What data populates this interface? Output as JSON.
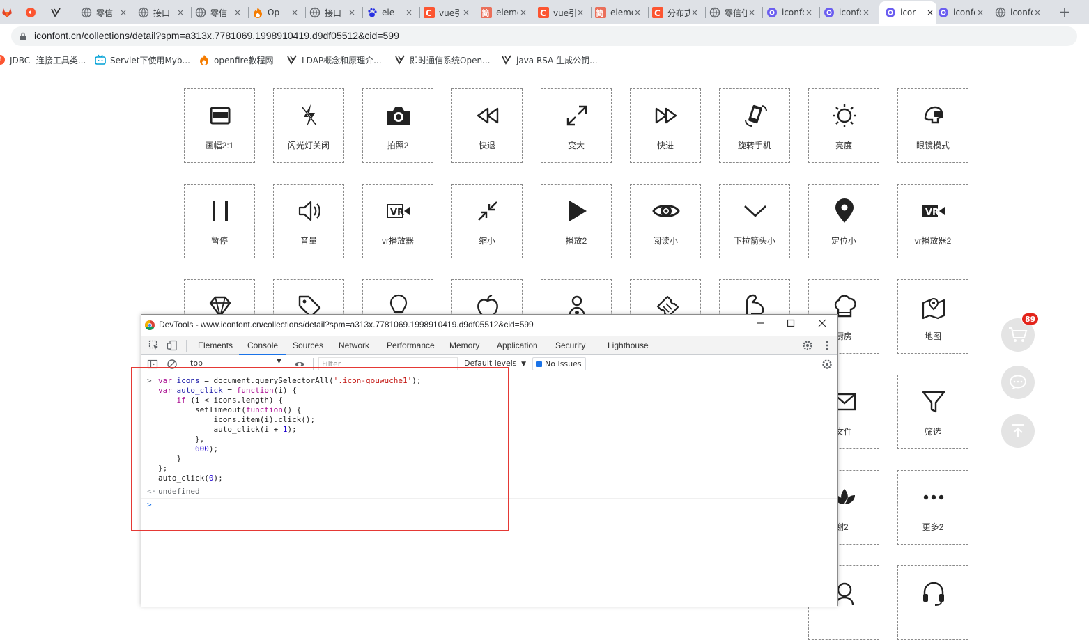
{
  "browser": {
    "tabs": [
      {
        "icon": "gitlab-icon",
        "title": ""
      },
      {
        "icon": "csdn-flame-icon",
        "title": ""
      },
      {
        "icon": "shield-check-icon",
        "title": ""
      },
      {
        "icon": "globe-icon",
        "title": "零信"
      },
      {
        "icon": "globe-icon",
        "title": "接口"
      },
      {
        "icon": "globe-icon",
        "title": "零信"
      },
      {
        "icon": "flame-icon",
        "title": "Op"
      },
      {
        "icon": "globe-icon",
        "title": "接口"
      },
      {
        "icon": "baidu-paw-icon",
        "title": "ele"
      },
      {
        "icon": "csdn-c-icon",
        "title": "vue引用"
      },
      {
        "icon": "jianshu-icon",
        "title": "elemen"
      },
      {
        "icon": "csdn-c-icon",
        "title": "vue引用"
      },
      {
        "icon": "jianshu-icon",
        "title": "elemen"
      },
      {
        "icon": "csdn-c-icon",
        "title": "分布式锁"
      },
      {
        "icon": "globe-icon",
        "title": "零信任"
      },
      {
        "icon": "iconfont-icon",
        "title": "iconfor"
      },
      {
        "icon": "iconfont-icon",
        "title": "iconfor"
      },
      {
        "icon": "iconfont-icon",
        "title": "icor"
      },
      {
        "icon": "iconfont-icon",
        "title": "iconfor"
      },
      {
        "icon": "globe-icon",
        "title": "iconfor"
      }
    ],
    "new_tab": "+",
    "url": "iconfont.cn/collections/detail?spm=a313x.7781069.1998910419.d9df05512&cid=599",
    "bookmarks": [
      {
        "icon": "csdn-flame-icon",
        "label": "JDBC--连接工具类..."
      },
      {
        "icon": "bilibili-icon",
        "label": "Servlet下使用Myb..."
      },
      {
        "icon": "flame-icon",
        "label": "openfire教程网"
      },
      {
        "icon": "shield-check-icon",
        "label": "LDAP概念和原理介..."
      },
      {
        "icon": "shield-check-icon",
        "label": "即时通信系统Open..."
      },
      {
        "icon": "shield-check-icon",
        "label": "java RSA 生成公钥..."
      }
    ]
  },
  "grid": {
    "rows": [
      [
        {
          "icon": "aspect-ratio-icon",
          "label": "画幅2:1"
        },
        {
          "icon": "flash-off-icon",
          "label": "闪光灯关闭"
        },
        {
          "icon": "camera-icon",
          "label": "拍照2"
        },
        {
          "icon": "rewind-icon",
          "label": "快退"
        },
        {
          "icon": "expand-icon",
          "label": "变大"
        },
        {
          "icon": "fast-forward-icon",
          "label": "快进"
        },
        {
          "icon": "rotate-phone-icon",
          "label": "旋转手机"
        },
        {
          "icon": "brightness-icon",
          "label": "亮度"
        },
        {
          "icon": "glasses-mode-icon",
          "label": "眼镜模式"
        }
      ],
      [
        {
          "icon": "pause-icon",
          "label": "暂停"
        },
        {
          "icon": "volume-icon",
          "label": "音量"
        },
        {
          "icon": "vr-player-icon",
          "label": "vr播放器"
        },
        {
          "icon": "shrink-icon",
          "label": "缩小"
        },
        {
          "icon": "play-icon",
          "label": "播放2"
        },
        {
          "icon": "eye-icon",
          "label": "阅读小"
        },
        {
          "icon": "chevron-down-icon",
          "label": "下拉箭头小"
        },
        {
          "icon": "location-pin-icon",
          "label": "定位小"
        },
        {
          "icon": "vr-player-filled-icon",
          "label": "vr播放器2"
        }
      ],
      [
        {
          "icon": "diamond-icon",
          "label": ""
        },
        {
          "icon": "tag-icon",
          "label": ""
        },
        {
          "icon": "lightbulb-icon",
          "label": ""
        },
        {
          "icon": "apple-icon",
          "label": ""
        },
        {
          "icon": "person-icon",
          "label": ""
        },
        {
          "icon": "ticket-icon",
          "label": ""
        },
        {
          "icon": "arm-icon",
          "label": ""
        },
        {
          "icon": "chef-hat-icon",
          "label": "厨房"
        },
        {
          "icon": "map-icon",
          "label": "地图"
        }
      ],
      [
        {
          "icon": "mail-icon",
          "label": "文件"
        },
        {
          "icon": "filter-icon",
          "label": "筛选"
        }
      ],
      [
        {
          "icon": "lotus-icon",
          "label": "谢2"
        },
        {
          "icon": "more-icon",
          "label": "更多2"
        }
      ],
      [
        {
          "icon": "user-headset-icon",
          "label": ""
        },
        {
          "icon": "headset-icon",
          "label": ""
        }
      ]
    ]
  },
  "side": {
    "cart_badge": "89"
  },
  "devtools": {
    "title": "DevTools - www.iconfont.cn/collections/detail?spm=a313x.7781069.1998910419.d9df05512&cid=599",
    "tabs": [
      "Elements",
      "Console",
      "Sources",
      "Network",
      "Performance",
      "Memory",
      "Application",
      "Security",
      "Lighthouse"
    ],
    "active_tab": "Console",
    "context": "top",
    "filter_placeholder": "Filter",
    "levels": "Default levels",
    "issues": "No Issues",
    "result": "undefined"
  },
  "annotation": {
    "color": "#e53935"
  }
}
